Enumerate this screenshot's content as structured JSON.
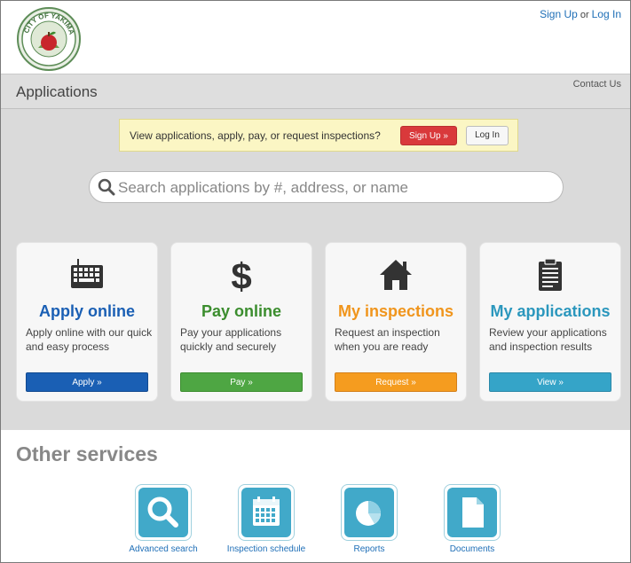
{
  "header": {
    "logo_text": "CITY OF YAKIMA",
    "sign_up_link": "Sign Up",
    "or_text": "or",
    "log_in_link": "Log In"
  },
  "titlebar": {
    "title": "Applications",
    "contact_link": "Contact Us"
  },
  "banner": {
    "message": "View applications, apply, pay, or request inspections?",
    "sign_up_button": "Sign Up »",
    "log_in_button": "Log In"
  },
  "search": {
    "placeholder": "Search applications by #, address, or name",
    "value": ""
  },
  "cards": [
    {
      "icon": "keyboard-icon",
      "title": "Apply online",
      "description": "Apply online with our quick and easy process",
      "button": "Apply »",
      "accent": "#1a5fb4"
    },
    {
      "icon": "dollar-icon",
      "title": "Pay online",
      "description": "Pay your applications quickly and securely",
      "button": "Pay »",
      "accent": "#3b8d2e"
    },
    {
      "icon": "house-icon",
      "title": "My inspections",
      "description": "Request an inspection when you are ready",
      "button": "Request »",
      "accent": "#f0951c"
    },
    {
      "icon": "clipboard-icon",
      "title": "My applications",
      "description": "Review your applications and inspection results",
      "button": "View »",
      "accent": "#2b97bd"
    }
  ],
  "other_services": {
    "heading": "Other services",
    "items": [
      {
        "icon": "magnifier-icon",
        "label": "Advanced search"
      },
      {
        "icon": "calendar-icon",
        "label": "Inspection schedule"
      },
      {
        "icon": "pie-chart-icon",
        "label": "Reports"
      },
      {
        "icon": "document-icon",
        "label": "Documents"
      }
    ]
  },
  "colors": {
    "link": "#1f6fb7",
    "signup_red": "#d9393b",
    "service_tile": "#41a9c9"
  }
}
